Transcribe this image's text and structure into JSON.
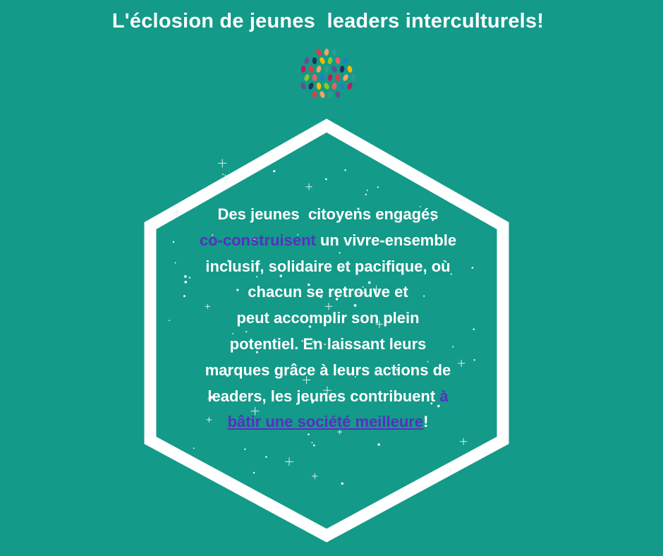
{
  "title": "L'éclosion de jeunes  leaders interculturels!",
  "colors": {
    "background": "#139a89",
    "frame": "#ffffff",
    "text": "#ffffff",
    "accent": "#5b2dc2"
  },
  "logo_icon": "multicolor-hands-circle-icon",
  "message": {
    "l1": "Des jeunes  citoyens engagés",
    "l2_accent": "co-construisent",
    "l2_rest": " un vivre-ensemble",
    "l3": "inclusif, solidaire et pacifique, où",
    "l4": "chacun se retrouve et",
    "l5": "peut accomplir son plein",
    "l6": "potentiel. En laissant leurs",
    "l7": "marques grâce à leurs actions de",
    "l8_rest": "leaders, les jeunes contribuent ",
    "l8_accent": "à",
    "l9_accent": "bâtir une société meilleure",
    "l9_rest": "!"
  }
}
